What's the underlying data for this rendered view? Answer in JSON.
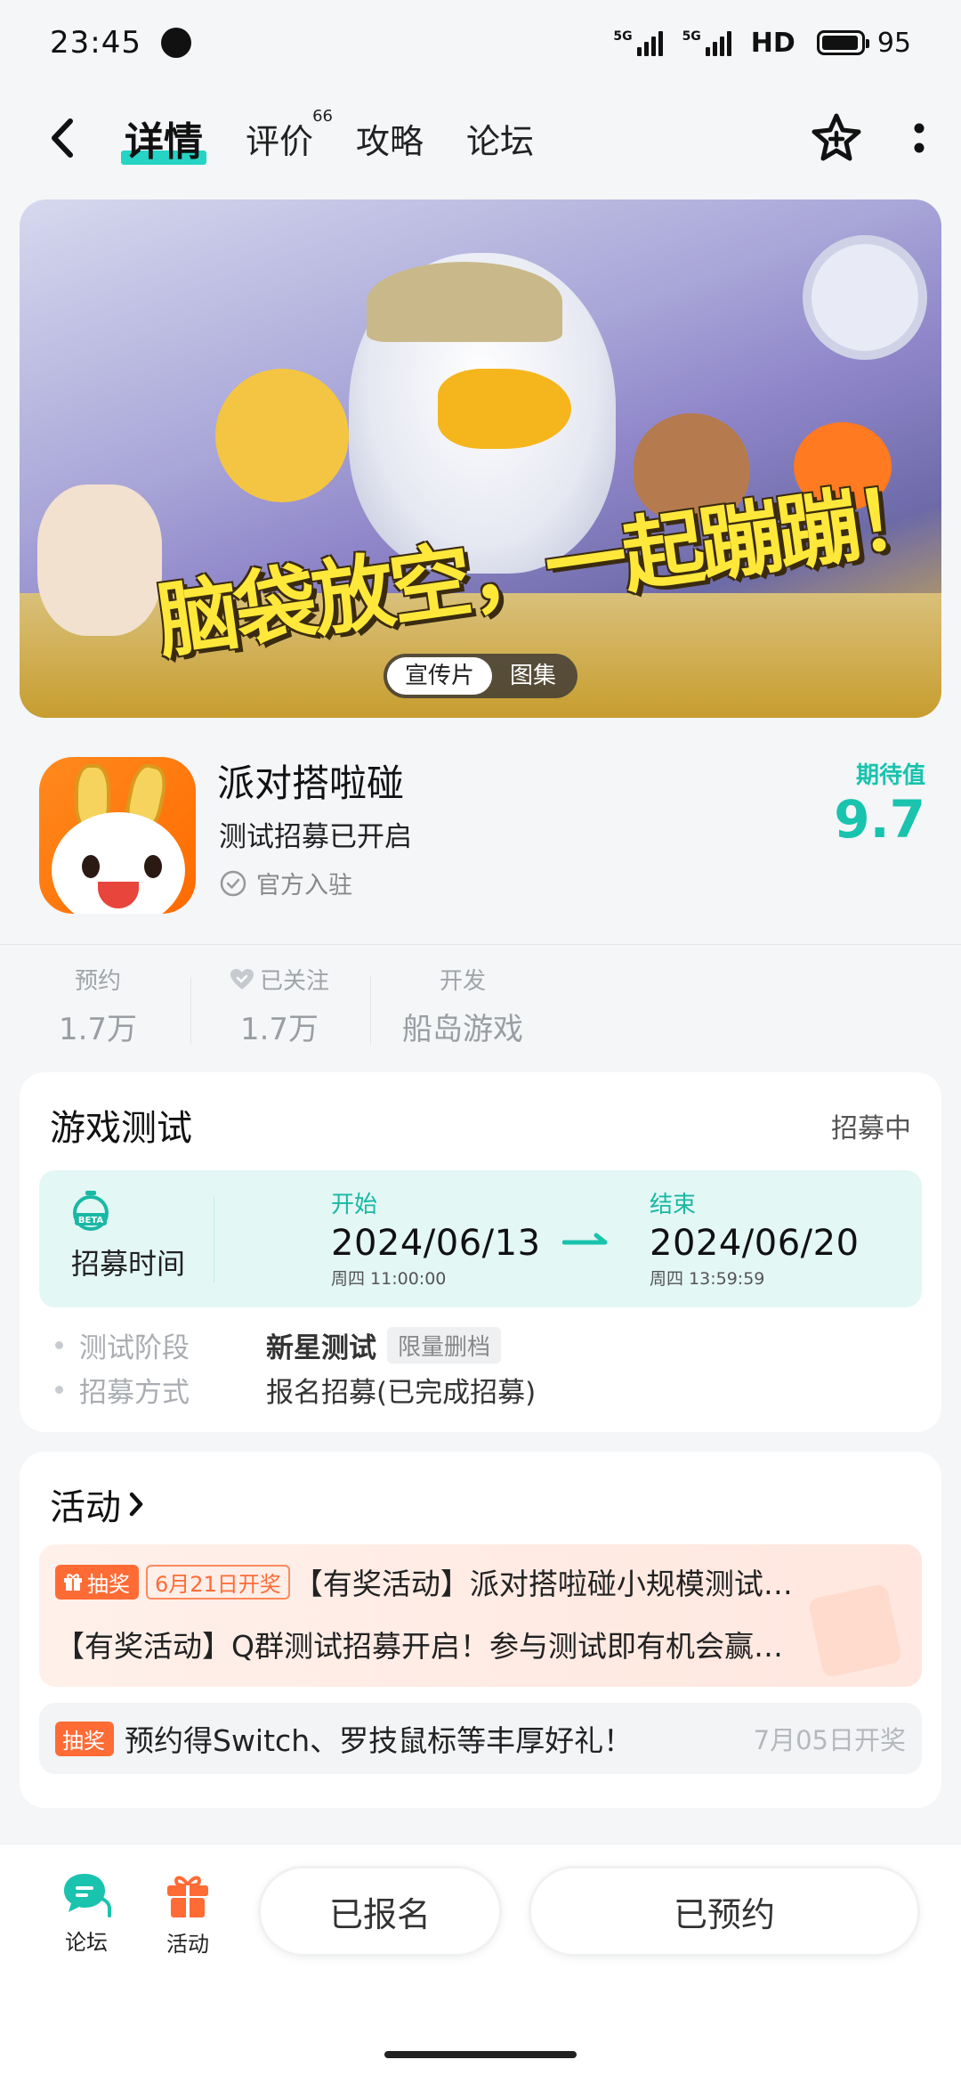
{
  "status_bar": {
    "time": "23:45",
    "net1": "5G",
    "net2": "5G",
    "hd": "HD",
    "battery": "95",
    "battery_level": 0.95
  },
  "nav": {
    "tabs": [
      {
        "label": "详情",
        "active": true
      },
      {
        "label": "评价",
        "badge": "66"
      },
      {
        "label": "攻略"
      },
      {
        "label": "论坛"
      }
    ]
  },
  "hero": {
    "logo_text": "脑袋放空，一起蹦蹦！",
    "media_tabs": [
      "宣传片",
      "图集"
    ],
    "selected_media_tab": "宣传片"
  },
  "app": {
    "name": "派对搭啦碰",
    "subtitle": "测试招募已开启",
    "official": "官方入驻",
    "rating_label": "期待值",
    "rating_value": "9.7"
  },
  "stats": [
    {
      "label": "预约",
      "value": "1.7万"
    },
    {
      "label": "已关注",
      "value": "1.7万",
      "icon": "heart-check-icon"
    },
    {
      "label": "开发",
      "value": "船岛游戏"
    }
  ],
  "test": {
    "title": "游戏测试",
    "status": "招募中",
    "recruit_label": "招募时间",
    "start_label": "开始",
    "start_date": "2024/06/13",
    "start_sub": "周四  11:00:00",
    "end_label": "结束",
    "end_date": "2024/06/20",
    "end_sub": "周四  13:59:59",
    "stage_label": "测试阶段",
    "stage_value": "新星测试",
    "stage_tag": "限量删档",
    "method_label": "招募方式",
    "method_value": "报名招募(已完成招募)"
  },
  "activity": {
    "title": "活动",
    "item1_badge": "抽奖",
    "item1_date_tag": "6月21日开奖",
    "item1_text": "【有奖活动】派对搭啦碰小规模测试…",
    "item1_line2": "【有奖活动】Q群测试招募开启！参与测试即有机会赢…",
    "item2_badge": "抽奖",
    "item2_text": "预约得Switch、罗技鼠标等丰厚好礼！",
    "item2_date": "7月05日开奖"
  },
  "bottom": {
    "forum_label": "论坛",
    "activity_label": "活动",
    "registered_label": "已报名",
    "reserved_label": "已预约"
  },
  "colors": {
    "accent": "#19c3ad",
    "orange": "#ff6b35"
  }
}
